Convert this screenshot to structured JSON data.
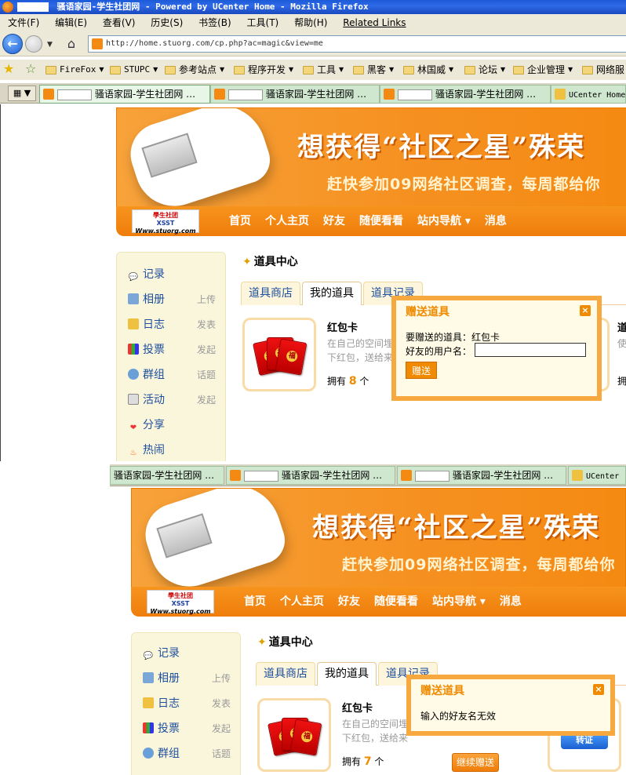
{
  "window": {
    "title": "骚语家园-学生社团网 - Powered by UCenter Home - Mozilla Firefox"
  },
  "menu": [
    "文件(F)",
    "编辑(E)",
    "查看(V)",
    "历史(S)",
    "书签(B)",
    "工具(T)",
    "帮助(H)",
    "Related Links"
  ],
  "address": {
    "url": "http://home.stuorg.com/cp.php?ac=magic&view=me"
  },
  "bookmarks": [
    {
      "label": "FireFox"
    },
    {
      "label": "STUPC"
    },
    {
      "label": "参考站点"
    },
    {
      "label": "程序开发"
    },
    {
      "label": "工具"
    },
    {
      "label": "黑客"
    },
    {
      "label": "林国威"
    },
    {
      "label": "论坛"
    },
    {
      "label": "企业管理"
    },
    {
      "label": "网络服"
    }
  ],
  "tabs_top": [
    {
      "label": "骚语家园-学生社团网 …"
    },
    {
      "label": "骚语家园-学生社团网 …"
    },
    {
      "label": "骚语家园-学生社团网 …"
    },
    {
      "label": "UCenter Home"
    }
  ],
  "tabs_bottom": [
    {
      "label": "骚语家园-学生社团网 …"
    },
    {
      "label": "骚语家园-学生社团网 …"
    },
    {
      "label": "骚语家园-学生社团网 …"
    },
    {
      "label": "UCenter"
    }
  ],
  "banner": {
    "headline": "想获得“社区之星”殊荣",
    "subline": "赶快参加09网络社区调查，每周都给你"
  },
  "logo": {
    "text1": "學生社团",
    "text2": "XSST",
    "text3": "Www.stuorg.com"
  },
  "site_nav": [
    "首页",
    "个人主页",
    "好友",
    "随便看看",
    "站内导航 ▾",
    "消息"
  ],
  "sidebar": [
    {
      "label": "记录",
      "action": "",
      "icon": "speech-icon"
    },
    {
      "label": "相册",
      "action": "上传",
      "icon": "photo-icon"
    },
    {
      "label": "日志",
      "action": "发表",
      "icon": "journal-icon"
    },
    {
      "label": "投票",
      "action": "发起",
      "icon": "poll-icon"
    },
    {
      "label": "群组",
      "action": "话题",
      "icon": "group-icon"
    },
    {
      "label": "活动",
      "action": "发起",
      "icon": "calendar-icon"
    },
    {
      "label": "分享",
      "action": "",
      "icon": "heart-icon"
    },
    {
      "label": "热闹",
      "action": "",
      "icon": "fire-icon"
    }
  ],
  "main": {
    "title": "道具中心",
    "tabs": [
      "道具商店",
      "我的道具",
      "道具记录"
    ],
    "item": {
      "name": "红包卡",
      "desc": "在自己的空间埋下红包，送给来访者",
      "owned_top_label": "拥有",
      "owned_top_count": "8",
      "owned_unit": "个",
      "owned_bottom_count": "7",
      "fu": "福"
    },
    "continue_button": "继续赠送",
    "next_item_partial": "道",
    "next_item_partial_desc": "使",
    "next_item_partial_own": "拥",
    "zhuanzheng": "转证"
  },
  "dialog_top": {
    "title": "赠送道具",
    "close": "×",
    "item_line": "要赠送的道具：红包卡",
    "username_label": "好友的用户名：",
    "username_value": "",
    "submit": "赠送"
  },
  "dialog_bottom": {
    "title": "赠送道具",
    "close": "×",
    "message": "输入的好友名无效"
  },
  "colors": {
    "accent": "#f08a00",
    "link": "#1d4f9e",
    "sidebar_bg": "#faf6dc"
  }
}
